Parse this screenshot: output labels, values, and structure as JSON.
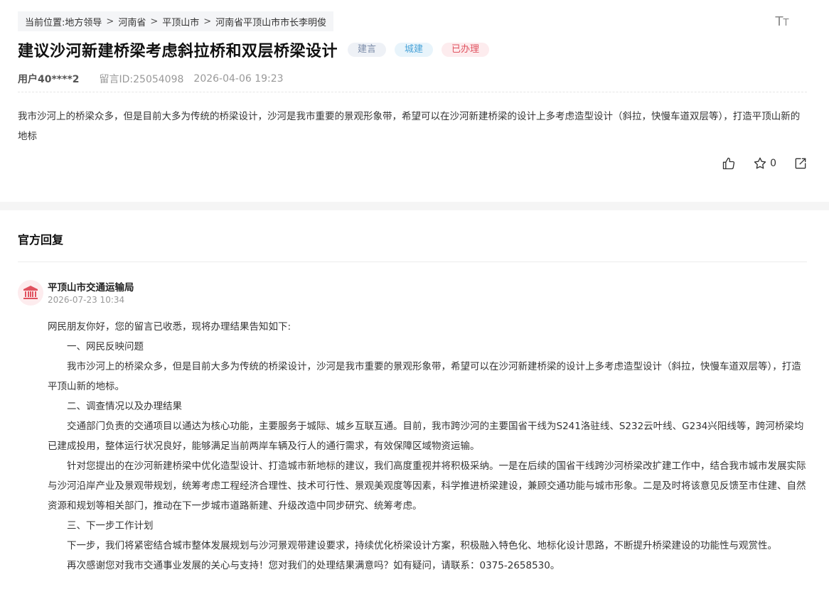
{
  "breadcrumb": {
    "prefix": "当前位置:",
    "items": [
      "地方领导",
      "河南省",
      "平顶山市",
      "河南省平顶山市市长李明俊"
    ]
  },
  "font_size_icon": "Tт",
  "message": {
    "title": "建议沙河新建桥梁考虑斜拉桥和双层桥梁设计",
    "tags": [
      "建言",
      "城建",
      "已办理"
    ],
    "user": "用户40****2",
    "msg_id": "留言ID:25054098",
    "time": "2026-04-06 19:23",
    "content": "我市沙河上的桥梁众多，但是目前大多为传统的桥梁设计，沙河是我市重要的景观形象带，希望可以在沙河新建桥梁的设计上多考虑造型设计（斜拉，快慢车道双层等），打造平顶山新的地标",
    "favorite_count": "0"
  },
  "reply": {
    "section_title": "官方回复",
    "department": "平顶山市交通运输局",
    "time": "2026-07-23 10:34",
    "paragraphs": [
      "网民朋友你好，您的留言已收悉，现将办理结果告知如下:",
      "一、网民反映问题",
      "我市沙河上的桥梁众多，但是目前大多为传统的桥梁设计，沙河是我市重要的景观形象带，希望可以在沙河新建桥梁的设计上多考虑造型设计（斜拉，快慢车道双层等），打造平顶山新的地标。",
      "二、调查情况以及办理结果",
      "交通部门负责的交通项目以通达为核心功能，主要服务于城际、城乡互联互通。目前，我市跨沙河的主要国省干线为S241洛驻线、S232云叶线、G234兴阳线等，跨河桥梁均已建成投用，整体运行状况良好，能够满足当前两岸车辆及行人的通行需求，有效保障区域物资运输。",
      "针对您提出的在沙河新建桥梁中优化造型设计、打造城市新地标的建议，我们高度重视并将积极采纳。一是在后续的国省干线跨沙河桥梁改扩建工作中，结合我市城市发展实际与沙河沿岸产业及景观带规划，统筹考虑工程经济合理性、技术可行性、景观美观度等因素，科学推进桥梁建设，兼顾交通功能与城市形象。二是及时将该意见反馈至市住建、自然资源和规划等相关部门，推动在下一步城市道路新建、升级改造中同步研究、统筹考虑。",
      "三、下一步工作计划",
      "下一步，我们将紧密结合城市整体发展规划与沙河景观带建设要求，持续优化桥梁设计方案，积极融入特色化、地标化设计思路，不断提升桥梁建设的功能性与观赏性。",
      "再次感谢您对我市交通事业发展的关心与支持！您对我们的处理结果满意吗？如有疑问，请联系：0375-2658530。"
    ]
  },
  "icons": {
    "like": "thumbs-up-icon",
    "favorite": "star-icon",
    "share": "share-icon",
    "font_size": "font-size-icon",
    "department": "government-building-icon"
  }
}
